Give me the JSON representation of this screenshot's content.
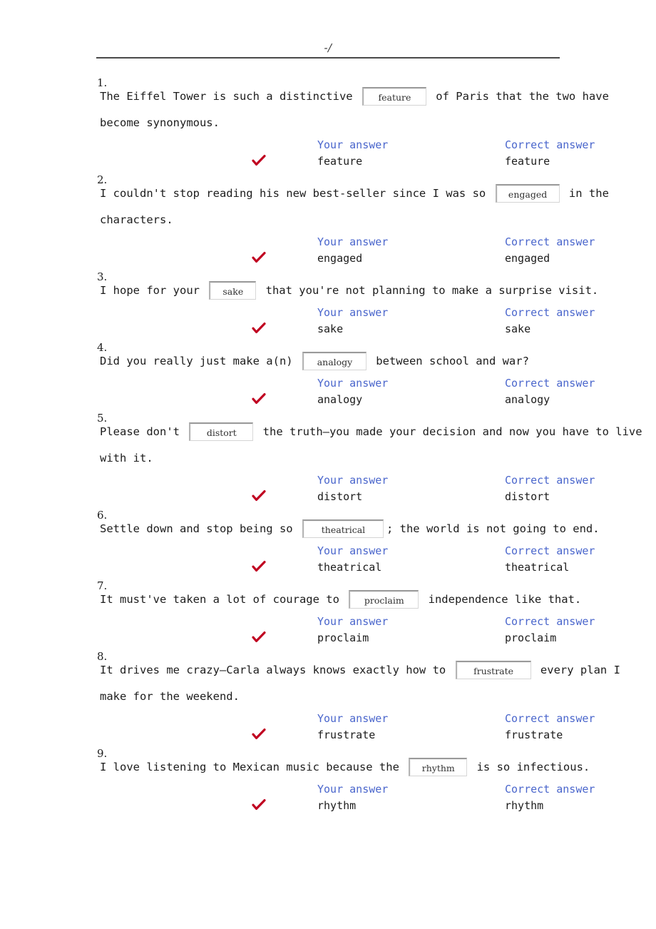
{
  "header": {
    "score": "-/",
    "rule": "horizontal-rule"
  },
  "labels": {
    "your_answer": "Your answer",
    "correct_answer": "Correct answer",
    "correct_mark": "check-mark"
  },
  "colors": {
    "label_blue": "#4a66cc",
    "check_red": "#c00020",
    "text": "#1c1c1c",
    "rule": "#4a4a4a"
  },
  "questions": [
    {
      "number": "1.",
      "before": "The Eiffel Tower is such a distinctive ",
      "blank": "feature",
      "after": " of Paris that the two have become synonymous.",
      "your_answer": "feature",
      "correct_answer": "feature",
      "is_correct": true
    },
    {
      "number": "2.",
      "before": "I couldn't stop reading his new best-seller since I was so ",
      "blank": "engaged",
      "after": " in the characters.",
      "your_answer": "engaged",
      "correct_answer": "engaged",
      "is_correct": true
    },
    {
      "number": "3.",
      "before": "I hope for your ",
      "blank": "sake",
      "after": " that you're not planning to make a surprise visit.",
      "your_answer": "sake",
      "correct_answer": "sake",
      "is_correct": true
    },
    {
      "number": "4.",
      "before": "Did you really just make a(n) ",
      "blank": "analogy",
      "after": " between school and war?",
      "your_answer": "analogy",
      "correct_answer": "analogy",
      "is_correct": true
    },
    {
      "number": "5.",
      "before": "Please don't ",
      "blank": "distort",
      "after": " the truth—you made your decision and now you have to live with it.",
      "your_answer": "distort",
      "correct_answer": "distort",
      "is_correct": true
    },
    {
      "number": "6.",
      "before": "Settle down and stop being so ",
      "blank": "theatrical",
      "after": "; the world is not going to end.",
      "your_answer": "theatrical",
      "correct_answer": "theatrical",
      "is_correct": true
    },
    {
      "number": "7.",
      "before": "It must've taken a lot of courage to ",
      "blank": "proclaim",
      "after": " independence like that.",
      "your_answer": "proclaim",
      "correct_answer": "proclaim",
      "is_correct": true
    },
    {
      "number": "8.",
      "before": "It drives me crazy—Carla always knows exactly how to ",
      "blank": "frustrate",
      "after": " every plan I make for the weekend.",
      "your_answer": "frustrate",
      "correct_answer": "frustrate",
      "is_correct": true
    },
    {
      "number": "9.",
      "before": "I love listening to Mexican music because the ",
      "blank": "rhythm",
      "after": " is so infectious.",
      "your_answer": "rhythm",
      "correct_answer": "rhythm",
      "is_correct": true
    }
  ]
}
